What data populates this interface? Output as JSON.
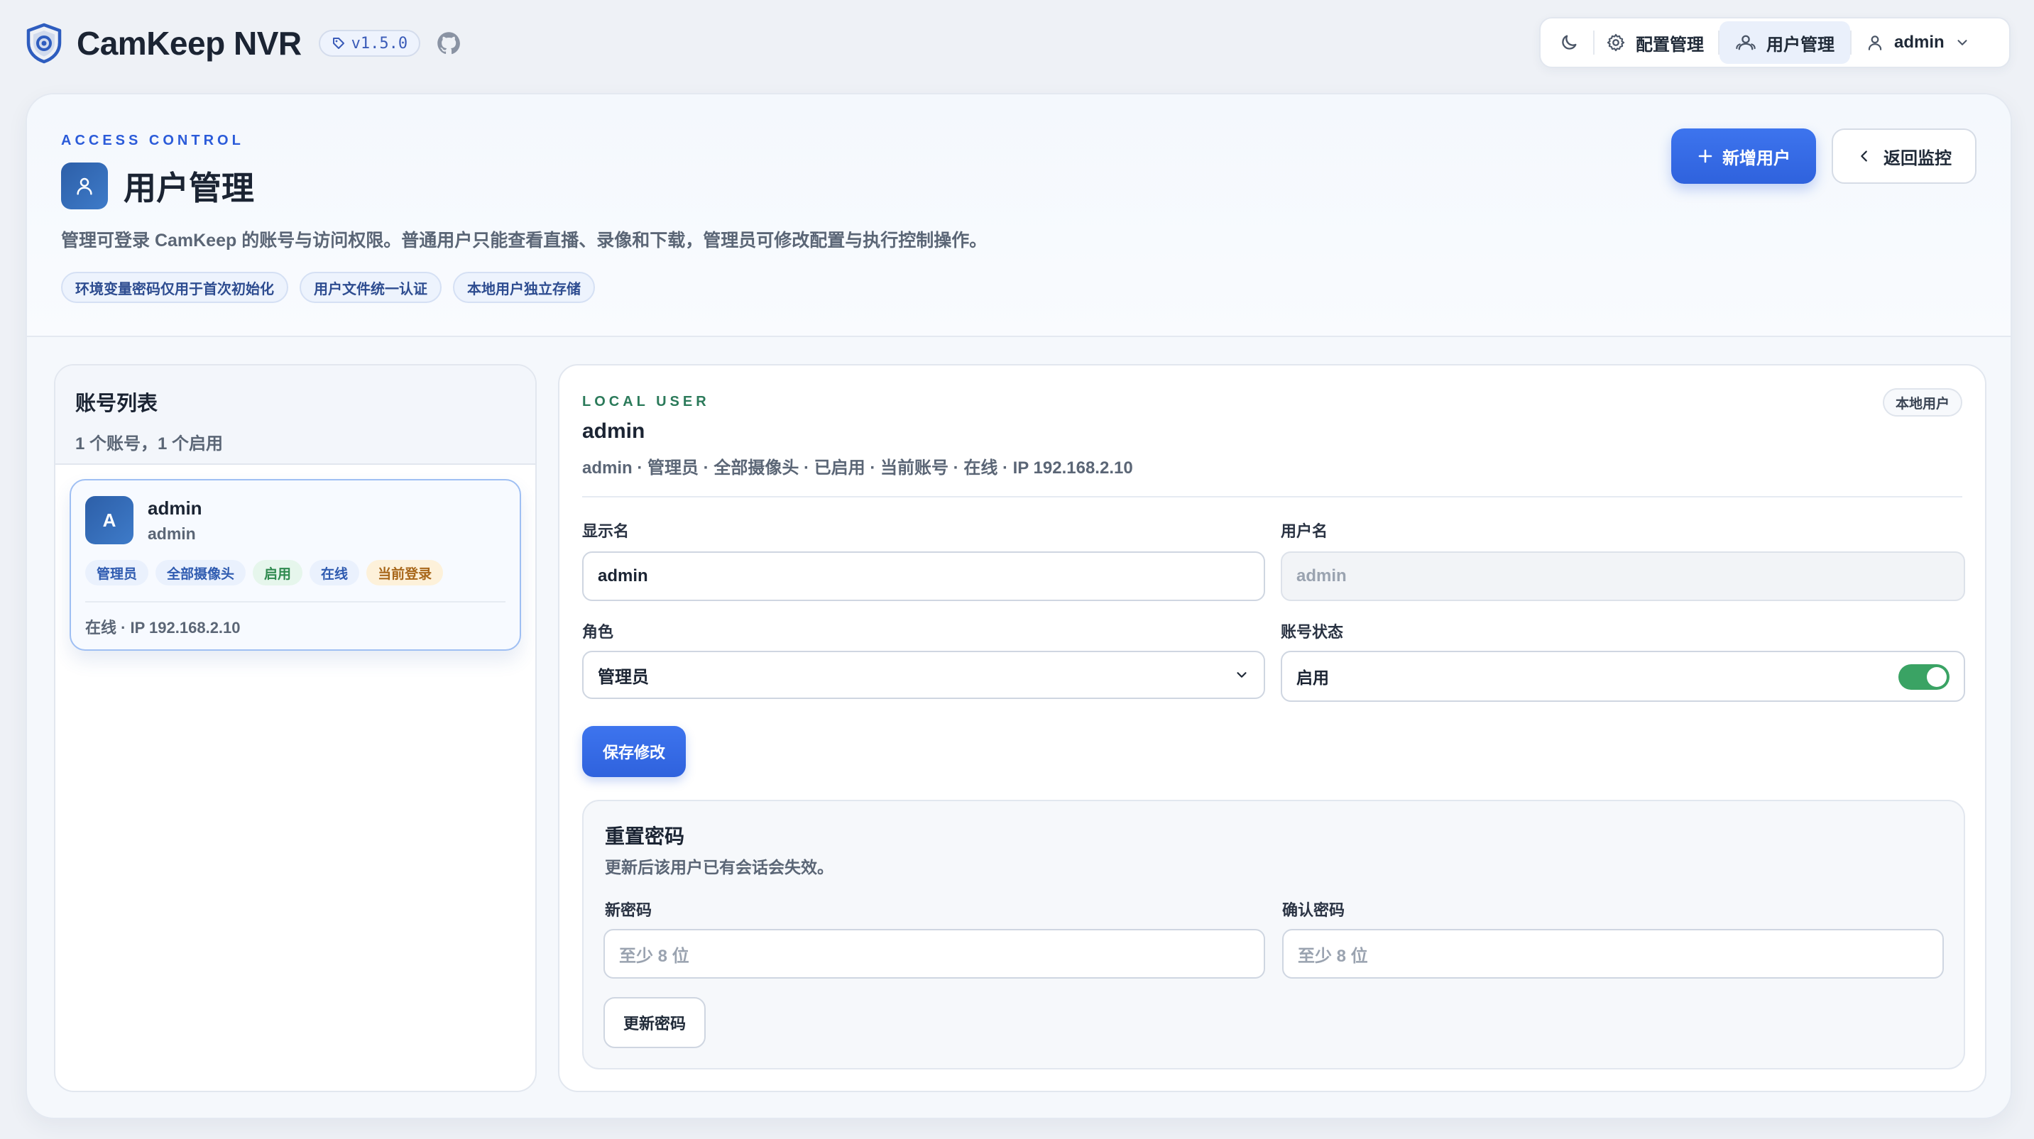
{
  "app": {
    "name": "CamKeep NVR",
    "version": "v1.5.0"
  },
  "nav": {
    "config_label": "配置管理",
    "users_label": "用户管理",
    "user_label": "admin"
  },
  "hero": {
    "eyebrow": "ACCESS CONTROL",
    "title": "用户管理",
    "description": "管理可登录 CamKeep 的账号与访问权限。普通用户只能查看直播、录像和下载，管理员可修改配置与执行控制操作。",
    "chips": [
      "环境变量密码仅用于首次初始化",
      "用户文件统一认证",
      "本地用户独立存储"
    ],
    "add_user_label": "新增用户",
    "back_label": "返回监控"
  },
  "account_list": {
    "title": "账号列表",
    "summary": "1 个账号，1 个启用",
    "users": [
      {
        "avatar": "A",
        "display_name": "admin",
        "username": "admin",
        "tags": [
          "管理员",
          "全部摄像头",
          "启用",
          "在线",
          "当前登录"
        ],
        "status_line": "在线 · IP 192.168.2.10"
      }
    ]
  },
  "detail": {
    "eyebrow": "LOCAL USER",
    "name": "admin",
    "meta": "admin · 管理员 · 全部摄像头 · 已启用 · 当前账号 · 在线 · IP 192.168.2.10",
    "badge": "本地用户",
    "fields": {
      "display_name_label": "显示名",
      "display_name_value": "admin",
      "username_label": "用户名",
      "username_value": "admin",
      "role_label": "角色",
      "role_value": "管理员",
      "status_label": "账号状态",
      "status_value": "启用",
      "status_enabled": true
    },
    "save_label": "保存修改",
    "reset": {
      "title": "重置密码",
      "subtitle": "更新后该用户已有会话会失效。",
      "new_label": "新密码",
      "new_placeholder": "至少 8 位",
      "confirm_label": "确认密码",
      "confirm_placeholder": "至少 8 位",
      "submit_label": "更新密码"
    }
  },
  "colors": {
    "primary": "#2f62dd",
    "success": "#3aa364",
    "accent_text": "#2b5bd9"
  }
}
